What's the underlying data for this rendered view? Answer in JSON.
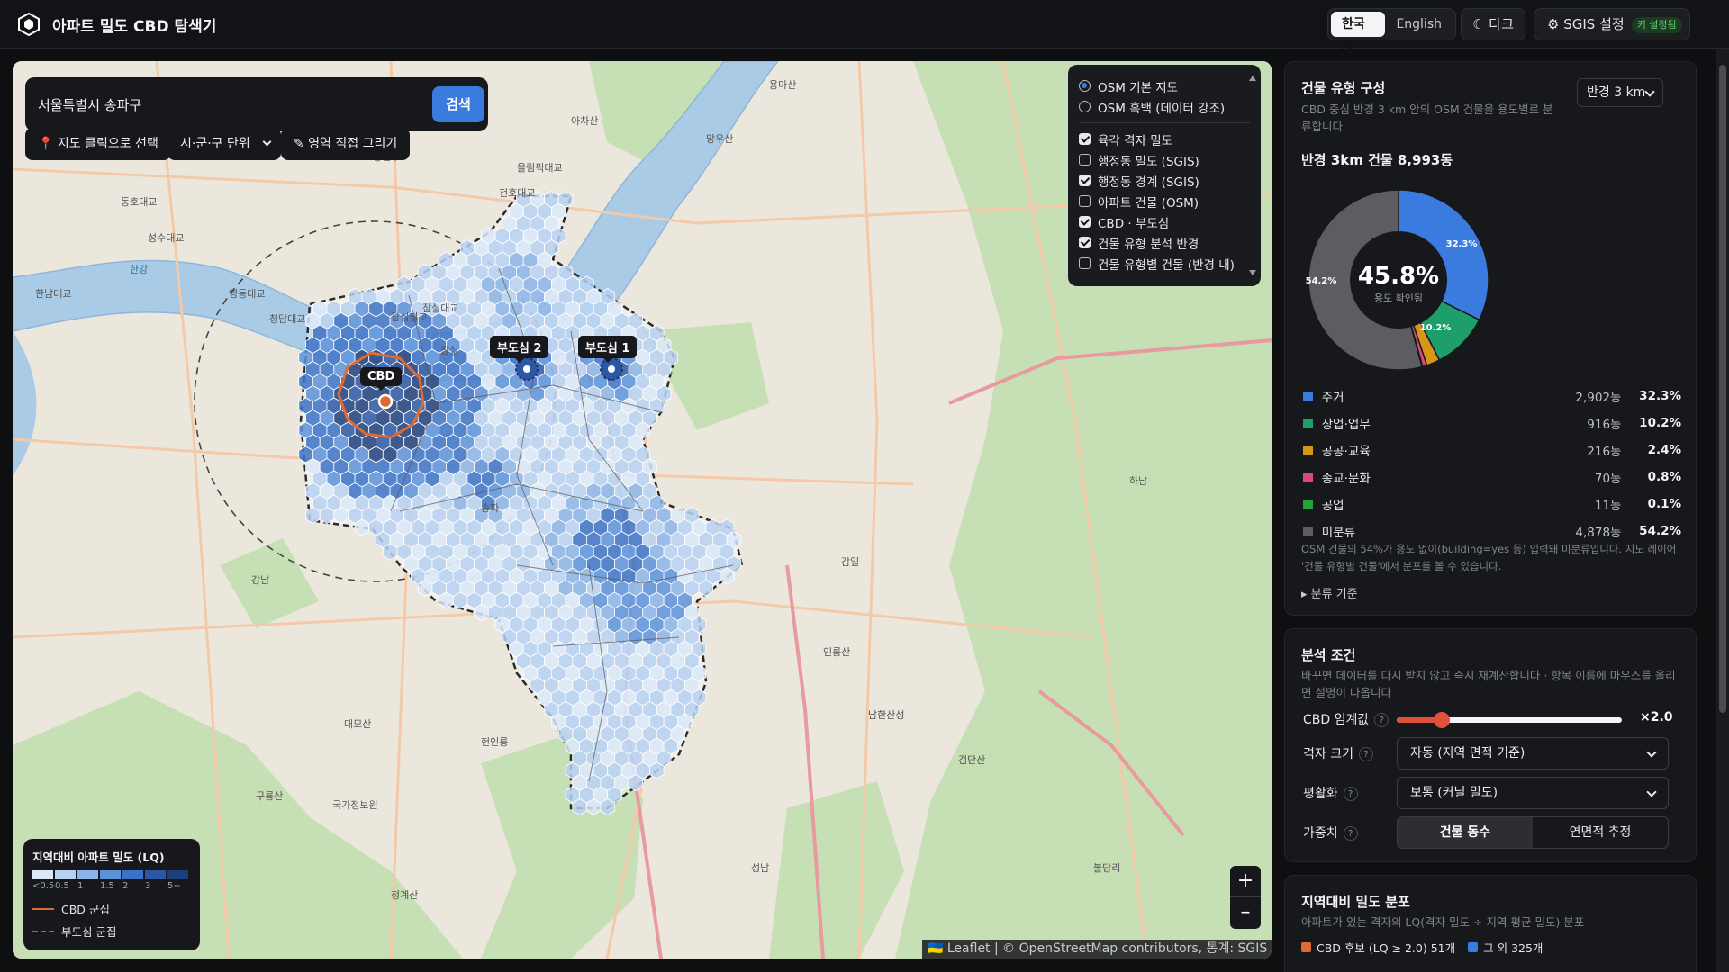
{
  "app": {
    "title": "아파트 밀도 CBD 탐색기",
    "lang_ko": "한국어",
    "lang_en": "English",
    "theme_button": "☾ 다크",
    "sgis_button": "⚙ SGIS 설정",
    "sgis_badge": "키 설정됨"
  },
  "map": {
    "search_value": "서울특별시 송파구",
    "search_button": "검색",
    "chip_click_select": "📍 지도 클릭으로 선택",
    "chip_unit": "시·군·구 단위",
    "chip_draw": "✎ 영역 직접 그리기",
    "layers": {
      "basemaps": [
        {
          "label": "OSM 기본 지도",
          "selected": true
        },
        {
          "label": "OSM 흑백 (데이터 강조)",
          "selected": false
        }
      ],
      "overlays": [
        {
          "label": "육각 격자 밀도",
          "checked": true
        },
        {
          "label": "행정동 밀도 (SGIS)",
          "checked": false
        },
        {
          "label": "행정동 경계 (SGIS)",
          "checked": true
        },
        {
          "label": "아파트 건물 (OSM)",
          "checked": false
        },
        {
          "label": "CBD · 부도심",
          "checked": true
        },
        {
          "label": "건물 유형 분석 반경",
          "checked": true
        },
        {
          "label": "건물 유형별 건물 (반경 내)",
          "checked": false
        }
      ]
    },
    "markers": {
      "cbd": "CBD",
      "sub1": "부도심 1",
      "sub2": "부도심 2"
    },
    "legend": {
      "title": "지역대비 아파트 밀도 (LQ)",
      "ramp_colors": [
        "#dbe8f8",
        "#b7d1f1",
        "#8bb4e8",
        "#5c92da",
        "#3b72c6",
        "#2b58a6",
        "#1f3f7c"
      ],
      "ticks": [
        "<0.5",
        "0.5",
        "1",
        "1.5",
        "2",
        "3",
        "5+"
      ],
      "cbd_line": "CBD 군집",
      "sub_line": "부도심 군집"
    },
    "zoom_in": "+",
    "zoom_out": "–",
    "attribution": "🇺🇦 Leaflet | © OpenStreetMap contributors, 통계: SGIS",
    "place_labels": [
      "한강",
      "잠실대교",
      "올림픽대교",
      "잠실철교",
      "천호대교",
      "영동대교",
      "청담대교",
      "동호대교",
      "성수대교",
      "한남대교",
      "잠실",
      "강남",
      "대모산",
      "구룡산",
      "국가정보원",
      "헌인릉",
      "청계산",
      "인릉산",
      "남한산성",
      "검단산",
      "불당리",
      "아차산",
      "용마산",
      "망우산",
      "광진구",
      "송파",
      "하남",
      "감일",
      "성남"
    ]
  },
  "building_types": {
    "title": "건물 유형 구성",
    "description": "CBD 중심 반경 3 km 안의 OSM 건물을 용도별로 분류합니다",
    "radius_select": "반경 3 km",
    "total_label": "반경 3km 건물 8,993동",
    "center_value": "45.8%",
    "center_caption": "용도 확인됨",
    "slice_labels": [
      "32.3%",
      "10.2%",
      "54.2%"
    ],
    "rows": [
      {
        "name": "주거",
        "count": "2,902동",
        "pct": "32.3%",
        "color": "#3a7be0"
      },
      {
        "name": "상업·업무",
        "count": "916동",
        "pct": "10.2%",
        "color": "#1e9e6a"
      },
      {
        "name": "공공·교육",
        "count": "216동",
        "pct": "2.4%",
        "color": "#d69617"
      },
      {
        "name": "종교·문화",
        "count": "70동",
        "pct": "0.8%",
        "color": "#d94a7a"
      },
      {
        "name": "공업",
        "count": "11동",
        "pct": "0.1%",
        "color": "#21a33a"
      },
      {
        "name": "미분류",
        "count": "4,878동",
        "pct": "54.2%",
        "color": "#5b5d62"
      }
    ],
    "note": "OSM 건물의 54%가 용도 없이(building=yes 등) 입력돼 미분류입니다. 지도 레이어 '건물 유형별 건물'에서 분포를 볼 수 있습니다.",
    "criteria_toggle": "▸ 분류 기준"
  },
  "analysis": {
    "title": "분석 조건",
    "description": "바꾸면 데이터를 다시 받지 않고 즉시 재계산합니다 · 항목 이름에 마우스를 올리면 설명이 나옵니다",
    "threshold_label": "CBD 임계값",
    "threshold_value": "×2.0",
    "threshold_fraction": 0.2,
    "grid_label": "격자 크기",
    "grid_value": "자동 (지역 면적 기준)",
    "smoothing_label": "평활화",
    "smoothing_value": "보통 (커널 밀도)",
    "weight_label": "가중치",
    "weight_options": [
      "건물 동수",
      "연면적 추정"
    ],
    "help": "?"
  },
  "distribution": {
    "title": "지역대비 밀도 분포",
    "description": "아파트가 있는 격자의 LQ(격자 밀도 ÷ 지역 평균 밀도) 분포",
    "legend_cbd": "CBD 후보 (LQ ≥ 2.0) 51개",
    "legend_other": "그 외 325개"
  }
}
